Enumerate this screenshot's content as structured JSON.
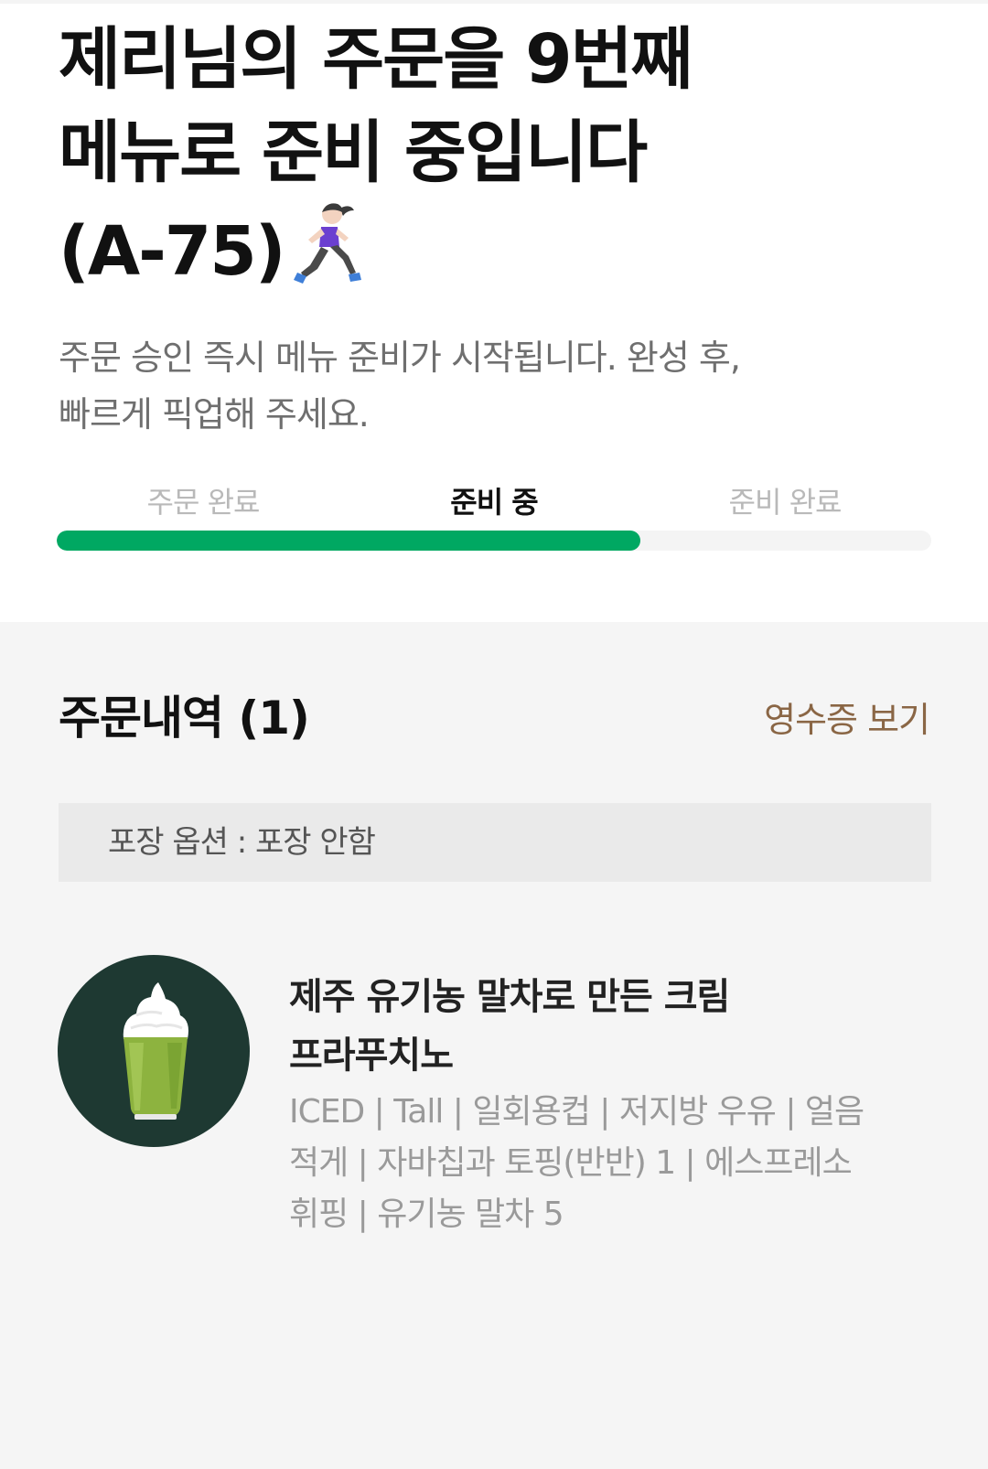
{
  "header": {
    "title_line1": "제리님의 주문을 9번째",
    "title_line2": "메뉴로 준비 중입니다",
    "title_line3": "(A-75)",
    "subtitle_line1": "주문 승인 즉시 메뉴 준비가 시작됩니다. 완성 후,",
    "subtitle_line2": "빠르게 픽업해 주세요."
  },
  "progress": {
    "steps": [
      {
        "label": "주문 완료",
        "state": "done"
      },
      {
        "label": "준비 중",
        "state": "current"
      },
      {
        "label": "준비 완료",
        "state": "pending"
      }
    ],
    "fraction": 0.667,
    "fill_color": "#00a862"
  },
  "order": {
    "section_title": "주문내역 (1)",
    "receipt_link": "영수증 보기",
    "packaging_option": "포장 옵션 : 포장 안함",
    "items": [
      {
        "name_line1": "제주 유기농 말차로 만든 크림",
        "name_line2": "프라푸치노",
        "options_line1": "ICED | Tall | 일회용컵 | 저지방 우유 | 얼음",
        "options_line2": "적게 | 자바칩과 토핑(반반) 1 | 에스프레소",
        "options_line3": "휘핑 | 유기농 말차 5",
        "image_icon": "matcha-frappuccino-image"
      }
    ]
  },
  "colors": {
    "accent_green": "#00a862",
    "link_brown": "#8a6645",
    "thumb_bg": "#1e3932"
  },
  "icons": {
    "runner": "woman-running-emoji"
  }
}
